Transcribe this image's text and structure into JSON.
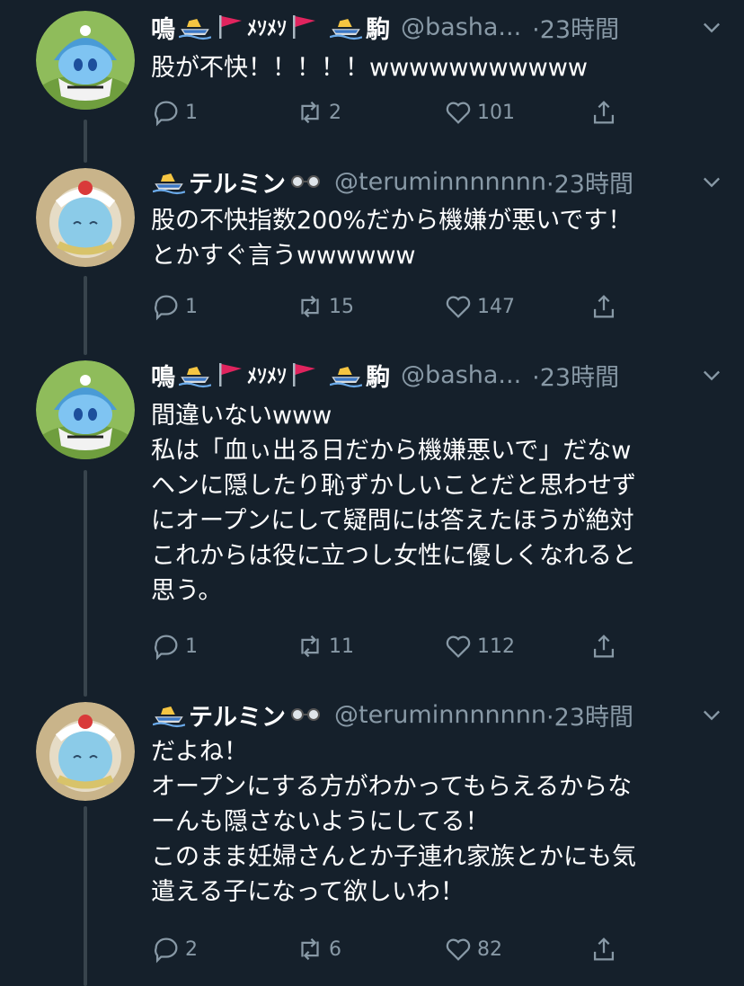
{
  "tweets": [
    {
      "name_parts": [
        "鳴",
        "駒"
      ],
      "name_mid": "ﾒｿﾒｿ",
      "handle": "@basha...",
      "time": "·23時間",
      "text": "股が不快！！！！！wwwwwwwwwww",
      "replies": "1",
      "retweets": "2",
      "likes": "101",
      "avatar": "shark-hood-plush"
    },
    {
      "name_parts": [
        "テルミン"
      ],
      "handle": "@teruminnnnnnn",
      "time": "·23時間",
      "text": "股の不快指数200%だから機嫌が悪いです！\nとかすぐ言うwwwwww",
      "replies": "1",
      "retweets": "15",
      "likes": "147",
      "avatar": "flower-crown-plush"
    },
    {
      "name_parts": [
        "鳴",
        "駒"
      ],
      "name_mid": "ﾒｿﾒｿ",
      "handle": "@basha...",
      "time": "·23時間",
      "text": "間違いないwww\n私は「血ぃ出る日だから機嫌悪いで」だなw\nヘンに隠したり恥ずかしいことだと思わせず\nにオープンにして疑問には答えたほうが絶対\nこれからは役に立つし女性に優しくなれると\n思う。",
      "replies": "1",
      "retweets": "11",
      "likes": "112",
      "avatar": "shark-hood-plush"
    },
    {
      "name_parts": [
        "テルミン"
      ],
      "handle": "@teruminnnnnnn",
      "time": "·23時間",
      "text": "だよね！\nオープンにする方がわかってもらえるからな\nーんも隠さないようにしてる！\nこのまま妊婦さんとか子連れ家族とかにも気\n遣える子になって欲しいわ！",
      "replies": "2",
      "retweets": "6",
      "likes": "82",
      "avatar": "flower-crown-plush"
    }
  ],
  "icons": {
    "reply": "reply-icon",
    "retweet": "retweet-icon",
    "like": "like-icon",
    "share": "share-icon",
    "menu": "chevron-down-icon",
    "boat": "boat-emoji-icon",
    "flag": "red-flag-emoji-icon",
    "glasses": "glasses-emoji-icon"
  },
  "colors": {
    "background": "#15202b",
    "text": "#ffffff",
    "secondary": "#8899a6",
    "thread_line": "#38444d",
    "flag": "#e0245e"
  }
}
